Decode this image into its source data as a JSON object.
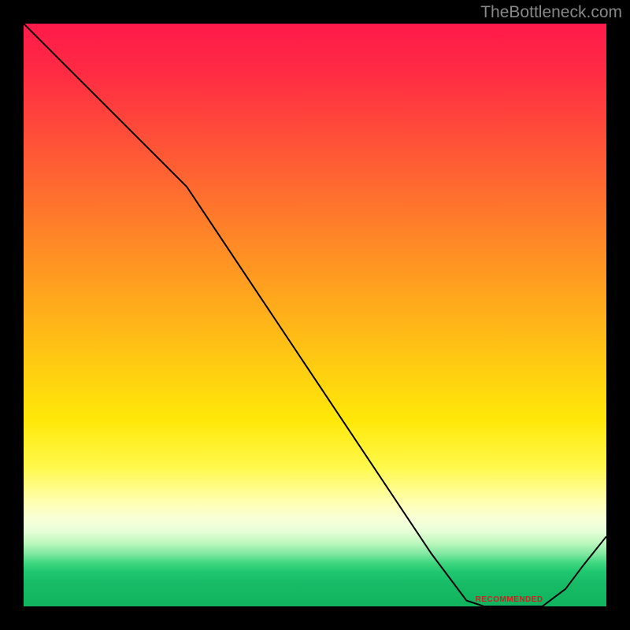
{
  "watermark": "TheBottleneck.com",
  "annotation_text": "RECOMMENDED",
  "chart_data": {
    "type": "line",
    "x": [
      0.0,
      0.06,
      0.12,
      0.18,
      0.24,
      0.28,
      0.34,
      0.4,
      0.46,
      0.52,
      0.58,
      0.64,
      0.7,
      0.76,
      0.79,
      0.84,
      0.89,
      0.93,
      0.96,
      1.0
    ],
    "y": [
      1.0,
      0.94,
      0.88,
      0.82,
      0.76,
      0.72,
      0.63,
      0.54,
      0.45,
      0.36,
      0.27,
      0.18,
      0.09,
      0.01,
      0.0,
      0.0,
      0.0,
      0.03,
      0.07,
      0.12
    ],
    "xlim": [
      0,
      1
    ],
    "ylim": [
      0,
      1
    ],
    "title": "",
    "xlabel": "",
    "ylabel": "",
    "line_color": "#000000",
    "line_width": 2,
    "annotation": {
      "text": "RECOMMENDED",
      "x": 0.84,
      "y": 0.005
    }
  }
}
